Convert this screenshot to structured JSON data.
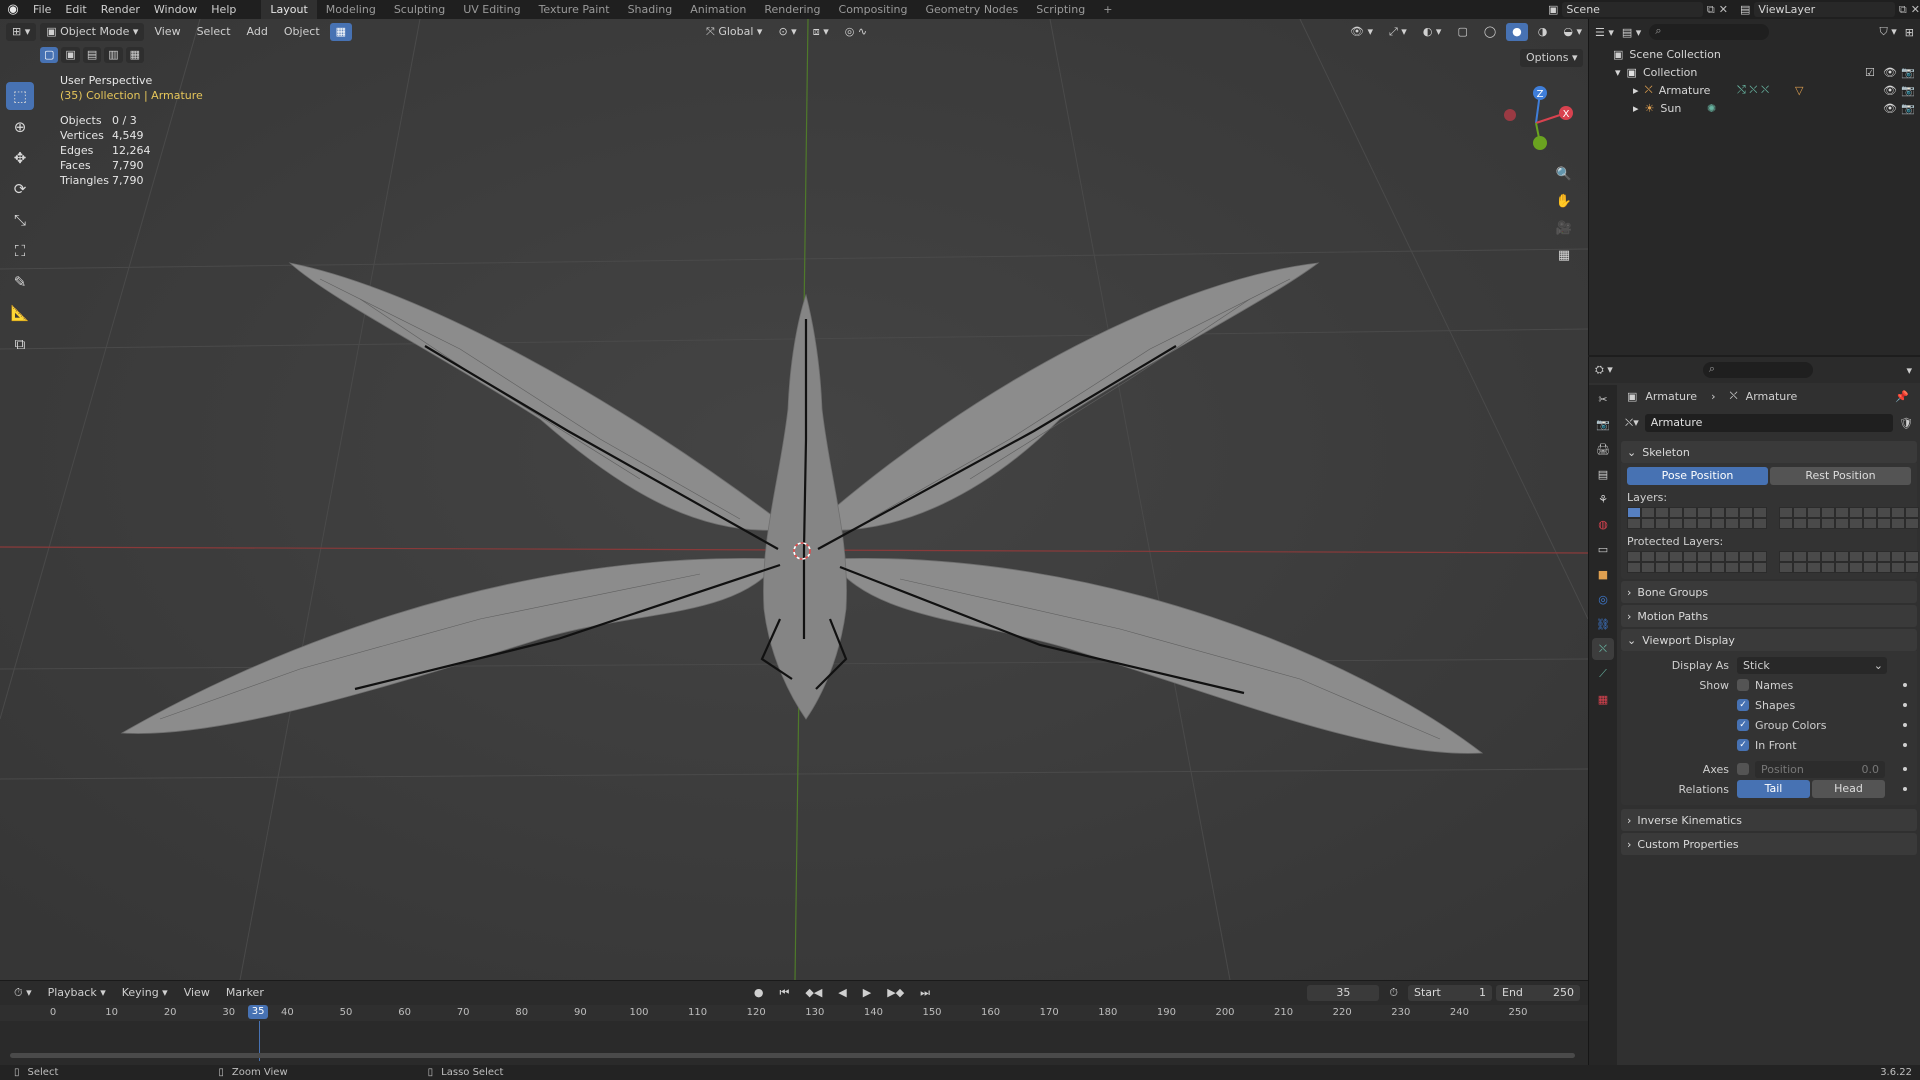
{
  "topbar": {
    "menus": [
      "File",
      "Edit",
      "Render",
      "Window",
      "Help"
    ],
    "workspaces": [
      "Layout",
      "Modeling",
      "Sculpting",
      "UV Editing",
      "Texture Paint",
      "Shading",
      "Animation",
      "Rendering",
      "Compositing",
      "Geometry Nodes",
      "Scripting"
    ],
    "active_workspace": "Layout",
    "add_tab": "+",
    "scene_name": "Scene",
    "view_layer_name": "ViewLayer"
  },
  "viewport": {
    "mode": "Object Mode",
    "menus": [
      "View",
      "Select",
      "Add",
      "Object"
    ],
    "transform_orientation": "Global",
    "options_label": "Options",
    "overlay_title": "User Perspective",
    "overlay_subtitle": "(35) Collection | Armature",
    "stats": [
      {
        "label": "Objects",
        "value": "0 / 3"
      },
      {
        "label": "Vertices",
        "value": "4,549"
      },
      {
        "label": "Edges",
        "value": "12,264"
      },
      {
        "label": "Faces",
        "value": "7,790"
      },
      {
        "label": "Triangles",
        "value": "7,790"
      }
    ],
    "gizmo_axes": {
      "z": "Z",
      "x": "X"
    },
    "accent_colors": {
      "x": "#d8424f",
      "y": "#6aa320",
      "z": "#3f7ed9",
      "select": "#4772b3"
    }
  },
  "timeline": {
    "menus": [
      "Playback",
      "Keying",
      "View",
      "Marker"
    ],
    "current_frame": "35",
    "start_label": "Start",
    "start_value": "1",
    "end_label": "End",
    "end_value": "250",
    "ticks": [
      "0",
      "10",
      "20",
      "30",
      "40",
      "50",
      "60",
      "70",
      "80",
      "90",
      "100",
      "110",
      "120",
      "130",
      "140",
      "150",
      "160",
      "170",
      "180",
      "190",
      "200",
      "210",
      "220",
      "230",
      "240",
      "250"
    ],
    "playhead_label": "35"
  },
  "statusbar": {
    "select": "Select",
    "zoom": "Zoom View",
    "lasso": "Lasso Select",
    "version": "3.6.22"
  },
  "outliner": {
    "root": "Scene Collection",
    "collection": "Collection",
    "items": [
      "Armature",
      "Sun"
    ]
  },
  "properties": {
    "breadcrumb_object": "Armature",
    "breadcrumb_data": "Armature",
    "data_name": "Armature",
    "skeleton": {
      "title": "Skeleton",
      "pose_position": "Pose Position",
      "rest_position": "Rest Position",
      "layers_label": "Layers:",
      "protected_label": "Protected Layers:"
    },
    "collapsed_panels_top": [
      "Bone Groups",
      "Motion Paths"
    ],
    "viewport_display": {
      "title": "Viewport Display",
      "display_as_label": "Display As",
      "display_as_value": "Stick",
      "show_label": "Show",
      "names": "Names",
      "shapes": "Shapes",
      "group_colors": "Group Colors",
      "in_front": "In Front",
      "axes_label": "Axes",
      "axes_position": "Position",
      "axes_value": "0.0",
      "relations_label": "Relations",
      "tail": "Tail",
      "head": "Head"
    },
    "collapsed_panels_bottom": [
      "Inverse Kinematics",
      "Custom Properties"
    ]
  }
}
